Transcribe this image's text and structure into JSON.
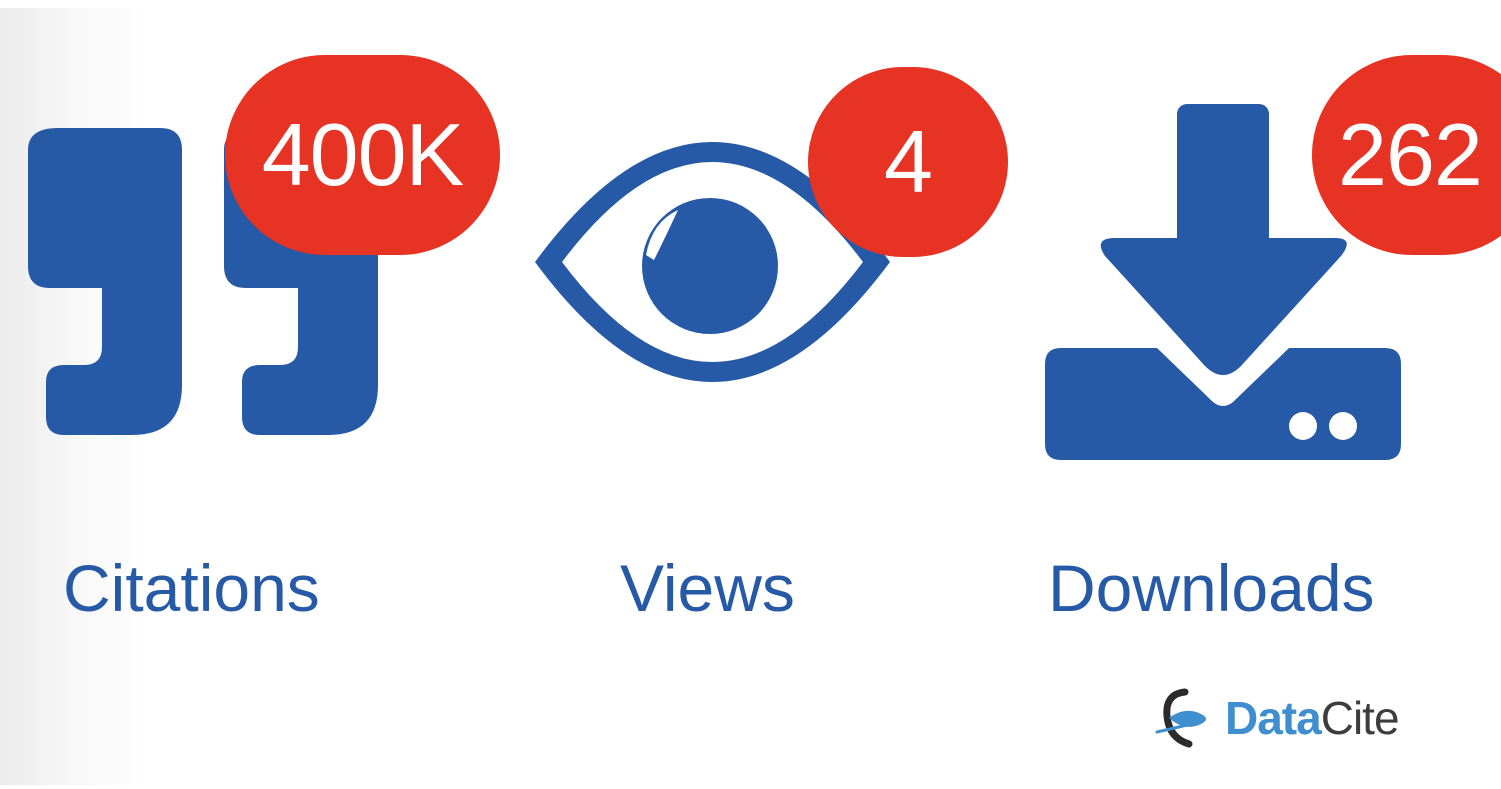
{
  "colors": {
    "icon_blue": "#2659a6",
    "badge_red": "#e63323",
    "badge_text": "#ffffff",
    "brand_data_blue": "#3e8ed0",
    "brand_cite_gray": "#3d3d3d"
  },
  "metrics": [
    {
      "id": "citations",
      "icon": "quote-icon",
      "count": "400K",
      "label": "Citations"
    },
    {
      "id": "views",
      "icon": "eye-icon",
      "count": "4",
      "label": "Views"
    },
    {
      "id": "downloads",
      "icon": "download-icon",
      "count": "262",
      "label": "Downloads"
    }
  ],
  "brand": {
    "logo_icon": "datacite-logo-icon",
    "name_part1": "Data",
    "name_part2": "Cite"
  }
}
